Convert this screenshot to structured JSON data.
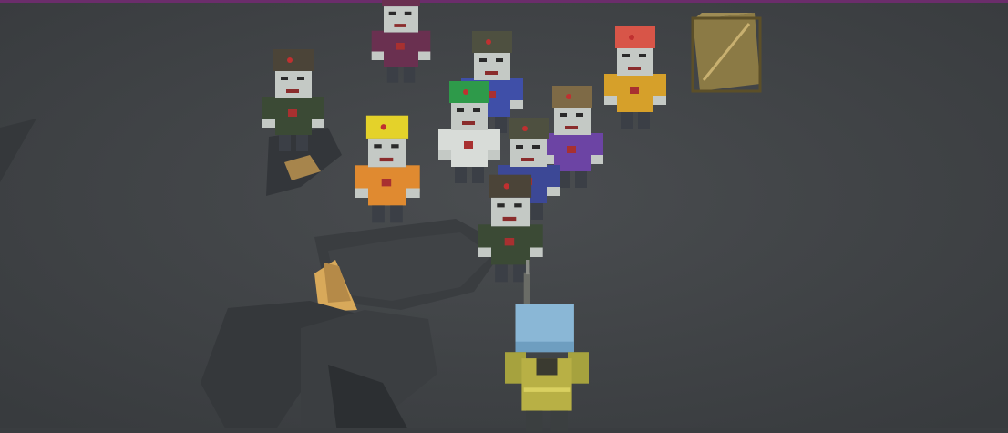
{
  "game": {
    "title": "",
    "colors": {
      "ground": "#43464a",
      "ground_light": "#4a4d50",
      "rock_dark": "#2f3235",
      "rock_mid": "#3a3d40",
      "crate": "#8b7a45",
      "crate_edge": "#6b5c30",
      "player_helmet": "#8ab7d6",
      "player_vest": "#b8b045"
    },
    "entities": [
      {
        "id": "zombie-soldier-1",
        "type": "zombie",
        "icon": "zombie-soldier-icon",
        "hat": "#4b4438",
        "body": "#3b4a35",
        "skin": "#c4c9c5"
      },
      {
        "id": "zombie-blue-cap",
        "type": "zombie",
        "icon": "zombie-soldier-icon",
        "hat": "#4e5040",
        "body": "#3f4fa8",
        "skin": "#c4c9c5"
      },
      {
        "id": "zombie-green-hat",
        "type": "zombie",
        "icon": "zombie-icon",
        "hat": "#2e9a4a",
        "body": "#d8dcd8",
        "skin": "#c4c9c5"
      },
      {
        "id": "zombie-hardhat",
        "type": "zombie",
        "icon": "zombie-worker-icon",
        "hat": "#e4d22a",
        "body": "#e08a30",
        "skin": "#c4c9c5"
      },
      {
        "id": "zombie-purple-2",
        "type": "zombie",
        "icon": "zombie-icon",
        "hat": "#7e6a46",
        "body": "#6c44a4",
        "skin": "#c4c9c5"
      },
      {
        "id": "zombie-red-hat",
        "type": "zombie",
        "icon": "zombie-icon",
        "hat": "#d85548",
        "body": "#d6a02a",
        "skin": "#c4c9c5"
      },
      {
        "id": "zombie-navy",
        "type": "zombie",
        "icon": "zombie-soldier-icon",
        "hat": "#4e5040",
        "body": "#3c4896",
        "skin": "#c4c9c5"
      },
      {
        "id": "zombie-soldier-2",
        "type": "zombie",
        "icon": "zombie-soldier-icon",
        "hat": "#4b4438",
        "body": "#3b4a35",
        "skin": "#c4c9c5"
      },
      {
        "id": "zombie-top-maroon",
        "type": "zombie",
        "icon": "zombie-icon",
        "hat": "#6a3050",
        "body": "#6a3050",
        "skin": "#c4c9c5"
      },
      {
        "id": "player",
        "type": "player",
        "icon": "player-soldier-icon",
        "hat": "#8ab7d6",
        "body": "#b8b045",
        "skin": "#d8c8a8"
      }
    ]
  }
}
